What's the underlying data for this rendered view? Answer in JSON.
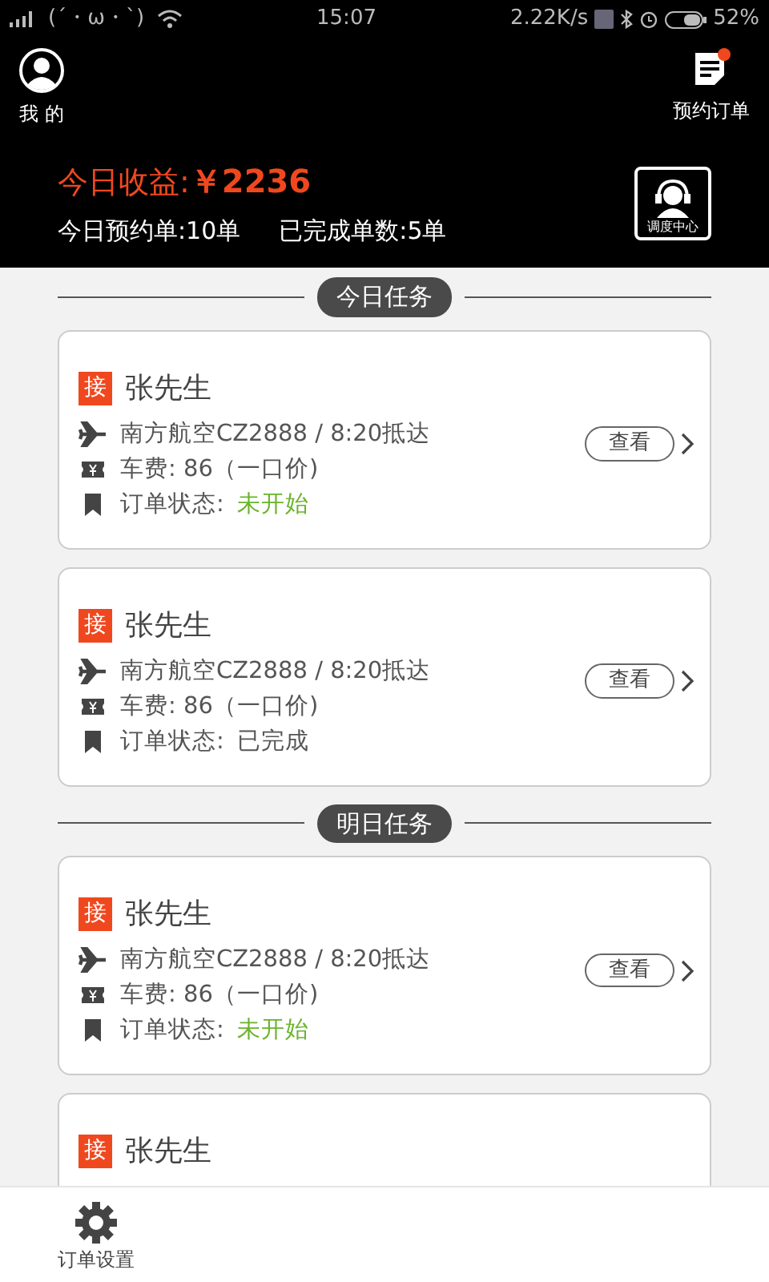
{
  "status_bar": {
    "carrier": "(´・ω・`)",
    "time": "15:07",
    "speed": "2.22K/s",
    "battery": "52%"
  },
  "header": {
    "profile_label": "我 的",
    "orders_label": "预约订单",
    "orders_unread": true,
    "earnings_label": "今日收益:",
    "earnings_value": "￥2236",
    "today_booked": "今日预约单:10单",
    "completed": "已完成单数:5单",
    "dispatch_label": "调度中心"
  },
  "sections": [
    {
      "title": "今日任务",
      "orders": [
        {
          "tag": "接",
          "name": "张先生",
          "flight": "南方航空CZ2888 / 8:20抵达",
          "fare": "车费:  86（一口价)",
          "status_label": "订单状态:",
          "status": "未开始",
          "completed": false,
          "action": "查看"
        },
        {
          "tag": "接",
          "name": "张先生",
          "flight": "南方航空CZ2888 / 8:20抵达",
          "fare": "车费:  86（一口价)",
          "status_label": "订单状态:",
          "status": "已完成",
          "completed": true,
          "action": "查看"
        }
      ]
    },
    {
      "title": "明日任务",
      "orders": [
        {
          "tag": "接",
          "name": "张先生",
          "flight": "南方航空CZ2888 / 8:20抵达",
          "fare": "车费:  86（一口价)",
          "status_label": "订单状态:",
          "status": "未开始",
          "completed": false,
          "action": "查看"
        },
        {
          "tag": "接",
          "name": "张先生"
        }
      ]
    }
  ],
  "bottom_bar": {
    "settings_label": "订单设置"
  }
}
